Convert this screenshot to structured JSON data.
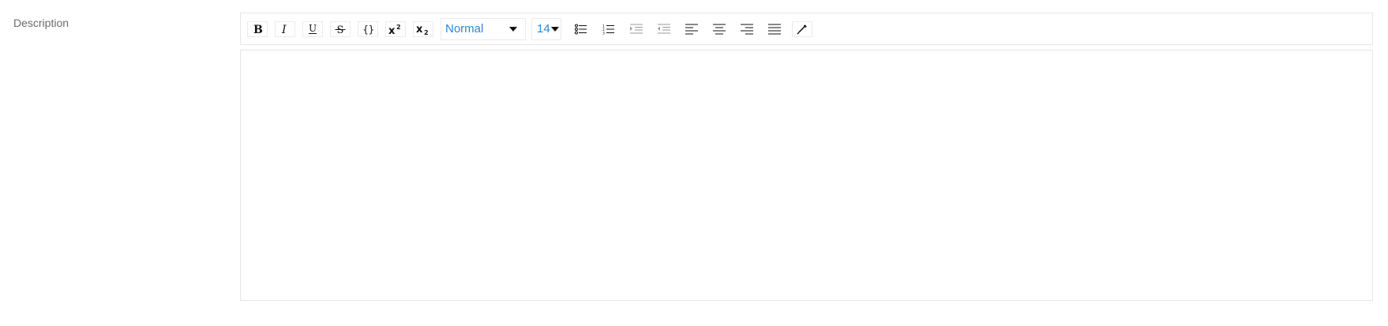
{
  "field": {
    "label": "Description"
  },
  "toolbar": {
    "buttons": [
      {
        "name": "bold-button",
        "icon": "bold-icon"
      },
      {
        "name": "italic-button",
        "icon": "italic-icon"
      },
      {
        "name": "underline-button",
        "icon": "underline-icon"
      },
      {
        "name": "strikethrough-button",
        "icon": "strikethrough-icon"
      },
      {
        "name": "code-button",
        "icon": "code-braces-icon"
      },
      {
        "name": "superscript-button",
        "icon": "superscript-icon"
      },
      {
        "name": "subscript-button",
        "icon": "subscript-icon"
      }
    ],
    "block_type": {
      "selected": "Normal"
    },
    "font_size": {
      "selected": "14"
    },
    "list_buttons": [
      {
        "name": "unordered-list-button",
        "icon": "bullet-list-icon"
      },
      {
        "name": "ordered-list-button",
        "icon": "numbered-list-icon"
      },
      {
        "name": "indent-button",
        "icon": "indent-icon"
      },
      {
        "name": "outdent-button",
        "icon": "outdent-icon"
      },
      {
        "name": "align-left-button",
        "icon": "align-left-icon"
      },
      {
        "name": "align-center-button",
        "icon": "align-center-icon"
      },
      {
        "name": "align-right-button",
        "icon": "align-right-icon"
      },
      {
        "name": "align-justify-button",
        "icon": "align-justify-icon"
      },
      {
        "name": "color-picker-button",
        "icon": "eyedropper-icon"
      }
    ]
  },
  "editor": {
    "content": ""
  },
  "colors": {
    "accent": "#2b88d8",
    "label": "#6b6b6b",
    "border": "#e6e6e6"
  }
}
